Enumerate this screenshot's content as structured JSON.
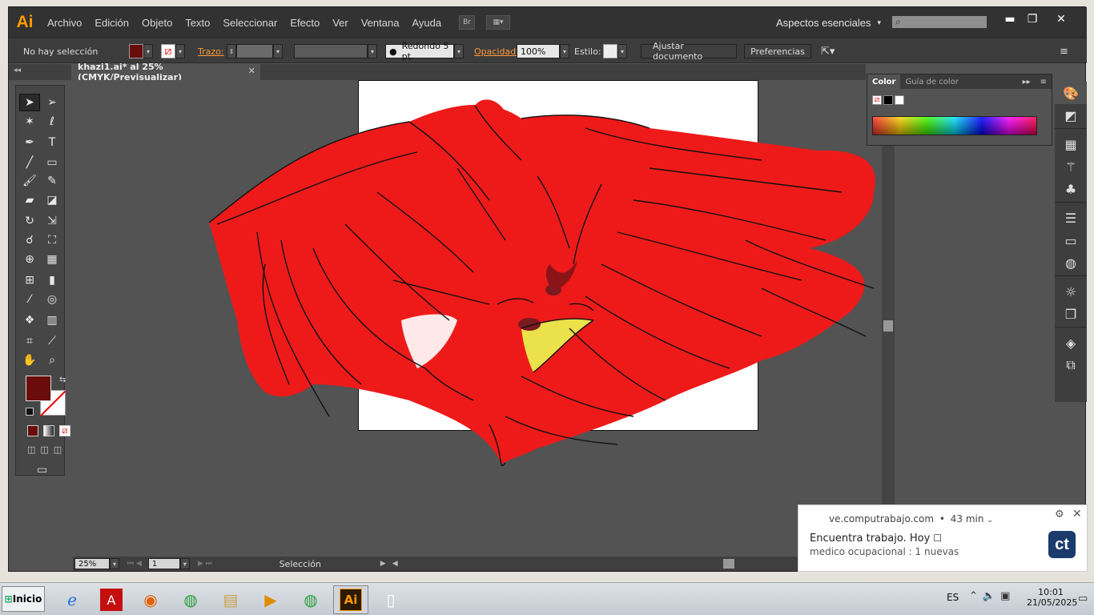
{
  "app": {
    "logo": "Ai"
  },
  "menus": [
    "Archivo",
    "Edición",
    "Objeto",
    "Texto",
    "Seleccionar",
    "Efecto",
    "Ver",
    "Ventana",
    "Ayuda"
  ],
  "bridge_label": "Br",
  "workspace": {
    "label": "Aspectos esenciales"
  },
  "window_controls": {
    "minimize": "▬",
    "maximize": "❐",
    "close": "✕"
  },
  "control_bar": {
    "selection": "No hay selección",
    "fill_color": "#6b0c0c",
    "stroke_label": "Trazo:",
    "brush": "Redondo 5 pt.",
    "opacity_label": "Opacidad:",
    "opacity_value": "100%",
    "style_label": "Estilo:",
    "fit_button": "Ajustar documento",
    "prefs_button": "Preferencias"
  },
  "document_tab": {
    "title": "khazi1.ai* al 25% (CMYK/Previsualizar)",
    "close": "✕"
  },
  "color_panel": {
    "tab_color": "Color",
    "tab_guide": "Guía de color"
  },
  "status": {
    "zoom": "25%",
    "page": "1",
    "tool": "Selección"
  },
  "notification": {
    "source": "ve.computrabajo.com",
    "time": "43 min",
    "title": "Encuentra trabajo. Hoy",
    "body": "medico ocupacional : 1 nuevas",
    "logo": "ct"
  },
  "taskbar": {
    "start": "Inicio",
    "lang": "ES",
    "time": "10:01",
    "date": "21/05/2025"
  }
}
